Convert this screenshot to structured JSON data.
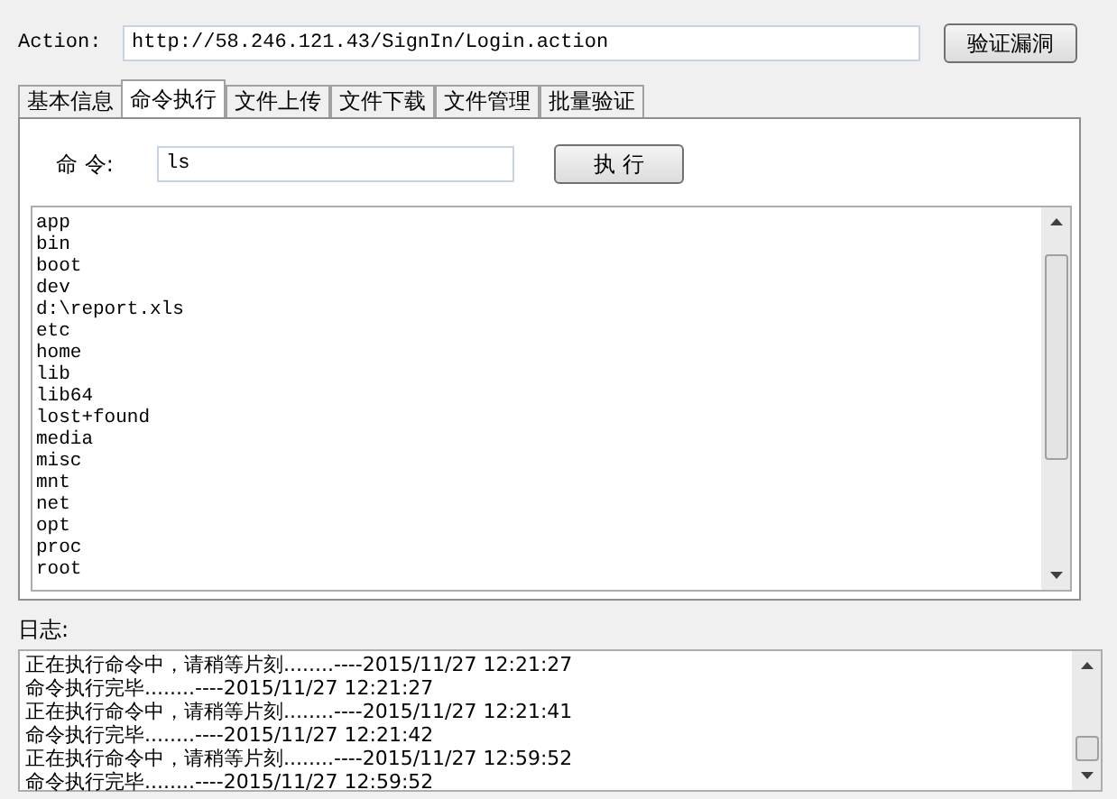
{
  "action": {
    "label": "Action:",
    "value": "http://58.246.121.43/SignIn/Login.action",
    "button": "验证漏洞"
  },
  "tabs": [
    {
      "label": "基本信息",
      "selected": false
    },
    {
      "label": "命令执行",
      "selected": true
    },
    {
      "label": "文件上传",
      "selected": false
    },
    {
      "label": "文件下载",
      "selected": false
    },
    {
      "label": "文件管理",
      "selected": false
    },
    {
      "label": "批量验证",
      "selected": false
    }
  ],
  "command": {
    "label": "命 令:",
    "value": "ls",
    "button": "执 行"
  },
  "output": [
    "app",
    "bin",
    "boot",
    "dev",
    "d:\\report.xls",
    "etc",
    "home",
    "lib",
    "lib64",
    "lost+found",
    "media",
    "misc",
    "mnt",
    "net",
    "opt",
    "proc",
    "root"
  ],
  "log": {
    "label": "日志:",
    "lines": [
      "正在执行命令中，请稍等片刻........----2015/11/27 12:21:27",
      "命令执行完毕........----2015/11/27 12:21:27",
      "正在执行命令中，请稍等片刻........----2015/11/27 12:21:41",
      "命令执行完毕........----2015/11/27 12:21:42",
      "正在执行命令中，请稍等片刻........----2015/11/27 12:59:52",
      "命令执行完毕........----2015/11/27 12:59:52"
    ]
  }
}
